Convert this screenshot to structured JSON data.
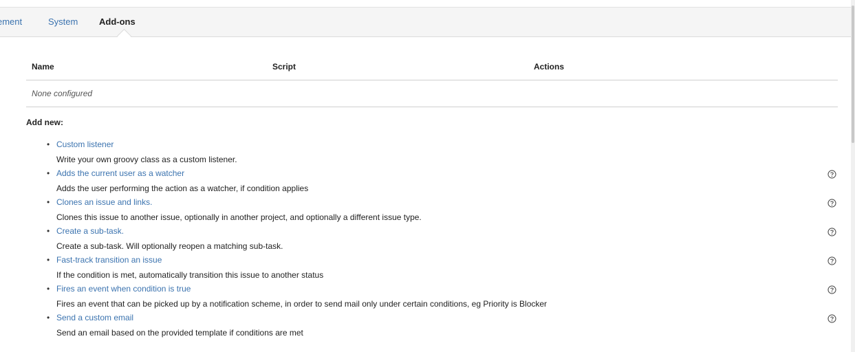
{
  "tabs": [
    {
      "label": "ement",
      "active": false
    },
    {
      "label": "System",
      "active": false
    },
    {
      "label": "Add-ons",
      "active": true
    }
  ],
  "table": {
    "columns": [
      "Name",
      "Script",
      "Actions"
    ],
    "empty_text": "None configured"
  },
  "add_new": {
    "title": "Add new:",
    "items": [
      {
        "label": "Custom listener",
        "description": "Write your own groovy class as a custom listener.",
        "help": false
      },
      {
        "label": "Adds the current user as a watcher",
        "description": "Adds the user performing the action as a watcher, if condition applies",
        "help": true
      },
      {
        "label": "Clones an issue and links.",
        "description": "Clones this issue to another issue, optionally in another project, and optionally a different issue type.",
        "help": true
      },
      {
        "label": "Create a sub-task.",
        "description": "Create a sub-task. Will optionally reopen a matching sub-task.",
        "help": true
      },
      {
        "label": "Fast-track transition an issue",
        "description": "If the condition is met, automatically transition this issue to another status",
        "help": true
      },
      {
        "label": "Fires an event when condition is true",
        "description": "Fires an event that can be picked up by a notification scheme, in order to send mail only under certain conditions, eg Priority is Blocker",
        "help": true
      },
      {
        "label": "Send a custom email",
        "description": "Send an email based on the provided template if conditions are met",
        "help": true
      }
    ]
  },
  "colors": {
    "link": "#3b73af",
    "tabbar_bg": "#f5f5f5",
    "divider": "#cfcfcf"
  },
  "icons": {
    "help": "question-circle-icon"
  }
}
